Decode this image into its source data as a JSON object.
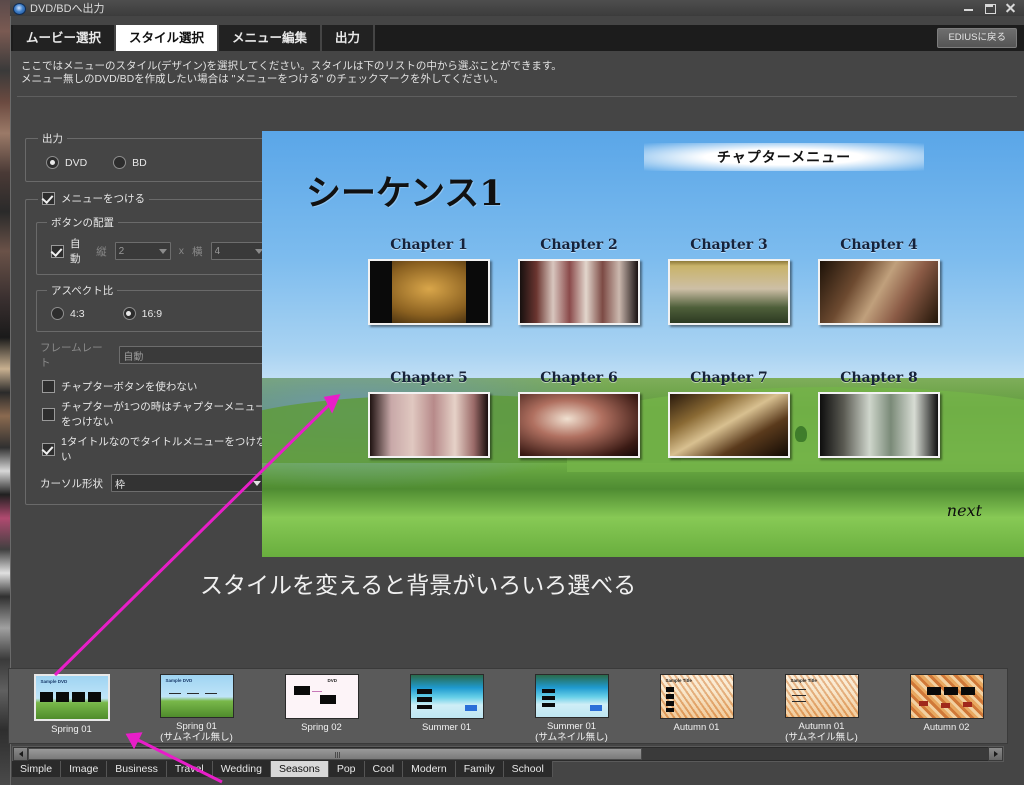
{
  "window": {
    "title": "DVD/BDへ出力",
    "icon": "dvd-disc-icon",
    "minimize": "minimize-icon",
    "maximize": "maximize-icon",
    "close": "close-icon"
  },
  "tabs": [
    {
      "label": "ムービー選択",
      "active": false
    },
    {
      "label": "スタイル選択",
      "active": true
    },
    {
      "label": "メニュー編集",
      "active": false
    },
    {
      "label": "出力",
      "active": false
    }
  ],
  "back_button": "EDIUSに戻る",
  "description": {
    "line1": "ここではメニューのスタイル(デザイン)を選択してください。スタイルは下のリストの中から選ぶことができます。",
    "line2": "メニュー無しのDVD/BDを作成したい場合は \"メニューをつける\" のチェックマークを外してください。"
  },
  "options": {
    "output_group": {
      "legend": "出力",
      "radios": [
        {
          "label": "DVD",
          "checked": true
        },
        {
          "label": "BD",
          "checked": false
        }
      ]
    },
    "menu_group": {
      "legend": "メニューをつける",
      "checked": true,
      "button_layout": {
        "legend": "ボタンの配置",
        "auto_label": "自動",
        "auto_checked": true,
        "rows_label": "縦",
        "rows_value": "2",
        "times_label": "x",
        "cols_label": "横",
        "cols_value": "4"
      },
      "aspect": {
        "legend": "アスペクト比",
        "radios": [
          {
            "label": "4:3",
            "checked": false
          },
          {
            "label": "16:9",
            "checked": true
          }
        ]
      },
      "framerate": {
        "label": "フレームレート",
        "value": "自動",
        "disabled": true
      },
      "checkboxes": [
        {
          "label": "チャプターボタンを使わない",
          "checked": false
        },
        {
          "label": "チャプターが1つの時はチャプターメニューをつけない",
          "checked": false
        },
        {
          "label": "1タイトルなのでタイトルメニューをつけない",
          "checked": true
        }
      ],
      "cursor_shape": {
        "label": "カーソル形状",
        "value": "枠"
      }
    }
  },
  "preview": {
    "sequence_title": "シーケンス1",
    "banner": "チャプターメニュー",
    "next_label": "next",
    "chapters": [
      {
        "label": "Chapter 1"
      },
      {
        "label": "Chapter 2"
      },
      {
        "label": "Chapter 3"
      },
      {
        "label": "Chapter 4"
      },
      {
        "label": "Chapter 5"
      },
      {
        "label": "Chapter 6"
      },
      {
        "label": "Chapter 7"
      },
      {
        "label": "Chapter 8"
      }
    ]
  },
  "caption": "スタイルを変えると背景がいろいろ選べる",
  "styles": [
    {
      "name": "Spring 01",
      "sub": "",
      "selected": true,
      "kind": "spring"
    },
    {
      "name": "Spring 01",
      "sub": "(サムネイル無し)",
      "selected": false,
      "kind": "spring-nothumb"
    },
    {
      "name": "Spring 02",
      "sub": "",
      "selected": false,
      "kind": "spring02"
    },
    {
      "name": "Summer 01",
      "sub": "",
      "selected": false,
      "kind": "summer"
    },
    {
      "name": "Summer 01",
      "sub": "(サムネイル無し)",
      "selected": false,
      "kind": "summer-nothumb"
    },
    {
      "name": "Autumn 01",
      "sub": "",
      "selected": false,
      "kind": "autumn-light"
    },
    {
      "name": "Autumn 01",
      "sub": "(サムネイル無し)",
      "selected": false,
      "kind": "autumn-light2"
    },
    {
      "name": "Autumn 02",
      "sub": "",
      "selected": false,
      "kind": "autumn"
    }
  ],
  "scrollbar": {
    "left_arrow": "chevron-left-icon",
    "right_arrow": "chevron-right-icon",
    "thumb_position_percent": 0
  },
  "categories": [
    {
      "label": "Simple",
      "active": false
    },
    {
      "label": "Image",
      "active": false
    },
    {
      "label": "Business",
      "active": false
    },
    {
      "label": "Travel",
      "active": false
    },
    {
      "label": "Wedding",
      "active": false
    },
    {
      "label": "Seasons",
      "active": true
    },
    {
      "label": "Pop",
      "active": false
    },
    {
      "label": "Cool",
      "active": false
    },
    {
      "label": "Modern",
      "active": false
    },
    {
      "label": "Family",
      "active": false
    },
    {
      "label": "School",
      "active": false
    }
  ],
  "annotation": {
    "color": "#e81ec8"
  }
}
